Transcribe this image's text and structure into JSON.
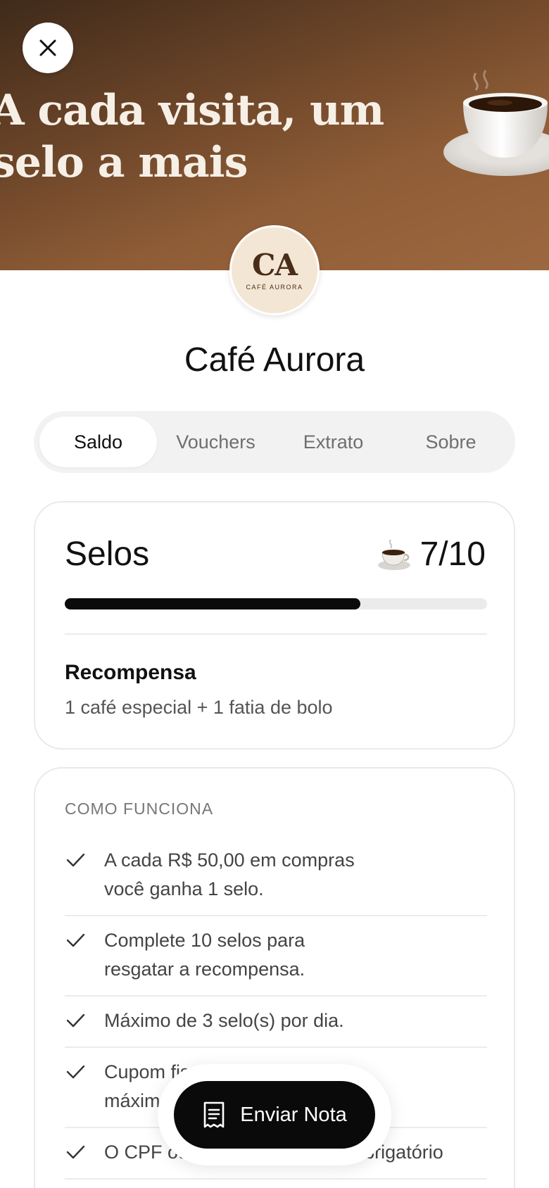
{
  "hero": {
    "title_line1": "A cada visita, um",
    "title_line2": "selo a mais",
    "close_icon": "close-icon",
    "illustration": "coffee-cup-illustration"
  },
  "store": {
    "logo_monogram": "CA",
    "logo_subtitle": "CAFÉ AURORA",
    "name": "Café Aurora"
  },
  "tabs": [
    {
      "label": "Saldo",
      "active": true
    },
    {
      "label": "Vouchers",
      "active": false
    },
    {
      "label": "Extrato",
      "active": false
    },
    {
      "label": "Sobre",
      "active": false
    }
  ],
  "selos": {
    "title": "Selos",
    "icon": "coffee-cup-icon",
    "count_text": "7/10",
    "current": 7,
    "total": 10,
    "progress": 0.7,
    "reward_label": "Recompensa",
    "reward_text": "1 café especial + 1 fatia de bolo"
  },
  "how": {
    "heading": "COMO FUNCIONA",
    "items": [
      "A cada R$ 50,00 em compras você ganha 1 selo.",
      "Complete 10 selos para resgatar a recompensa.",
      "Máximo de 3 selo(s) por dia.",
      "Cupom fiscal com data máxima",
      "O CPF ou CNPJ no cupom é obrigatório"
    ]
  },
  "fab": {
    "label": "Enviar Nota",
    "icon": "receipt-icon"
  },
  "colors": {
    "hero_dark": "#3f2a1a",
    "hero_light": "#9d6840",
    "accent": "#0a0a0a",
    "logo_bg": "#f3e6d4"
  }
}
